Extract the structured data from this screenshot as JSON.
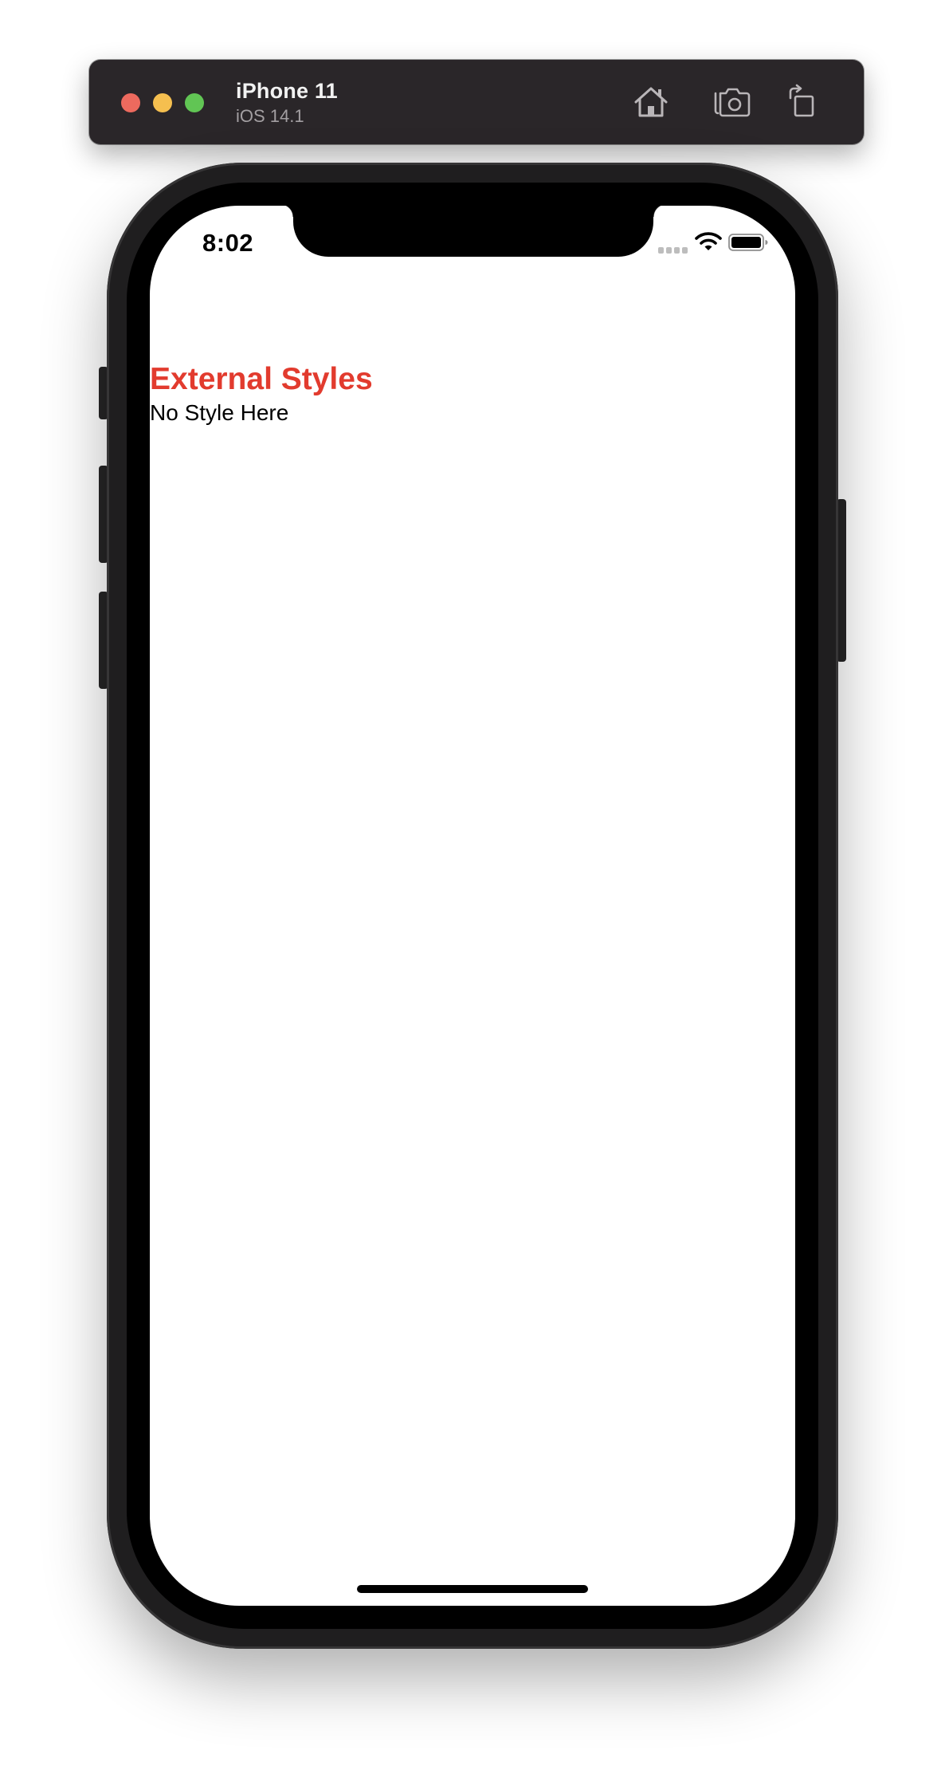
{
  "simulator": {
    "device_name": "iPhone 11",
    "os_version": "iOS 14.1",
    "toolbar": {
      "home_icon": "home-icon",
      "screenshot_icon": "camera-icon",
      "rotate_icon": "rotate-icon"
    },
    "colors": {
      "titlebar": "#2a2629",
      "close": "#ed6a5e",
      "minimize": "#f5bf4f",
      "maximize": "#61c554"
    }
  },
  "status_bar": {
    "time": "8:02"
  },
  "app": {
    "heading": "External Styles",
    "body_text": "No Style Here",
    "heading_color": "#e23b2e"
  }
}
